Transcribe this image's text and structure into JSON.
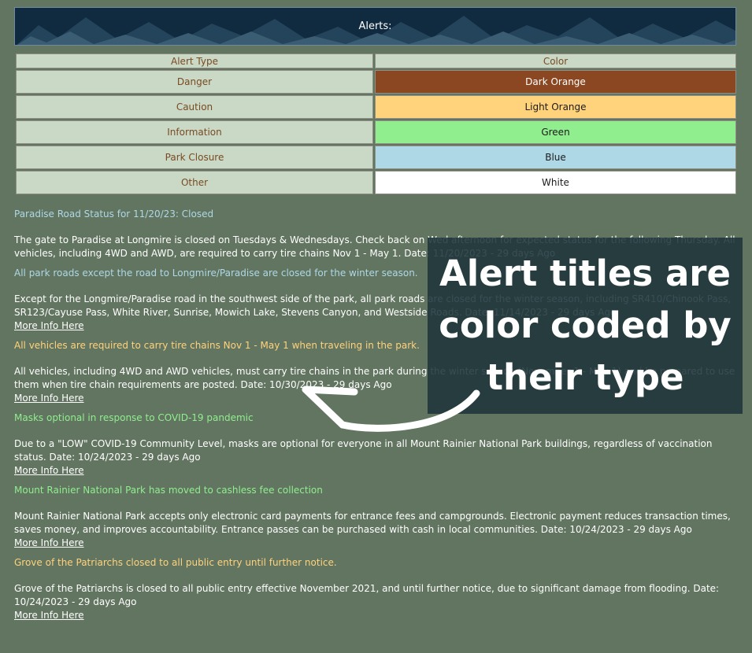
{
  "banner": {
    "title": "Alerts:"
  },
  "legend": {
    "headers": [
      "Alert Type",
      "Color"
    ],
    "rows": [
      {
        "type": "Danger",
        "color": "Dark Orange",
        "swatch": "#8b4722",
        "text_color": "#ffffff"
      },
      {
        "type": "Caution",
        "color": "Light Orange",
        "swatch": "#ffd27c",
        "text_color": "#1b1b1b"
      },
      {
        "type": "Information",
        "color": "Green",
        "swatch": "#90ee8f",
        "text_color": "#1b1b1b"
      },
      {
        "type": "Park Closure",
        "color": "Blue",
        "swatch": "#aed8e6",
        "text_color": "#1b1b1b"
      },
      {
        "type": "Other",
        "color": "White",
        "swatch": "#ffffff",
        "text_color": "#1b1b1b"
      }
    ]
  },
  "alerts": [
    {
      "title": "Paradise Road Status for 11/20/23: Closed",
      "title_color": "#aed8e6",
      "body": "The gate to Paradise at Longmire is closed on Tuesdays & Wednesdays. Check back on Wed afternoon for expected status for the following Thursday. All vehicles, including 4WD and AWD, are required to carry tire chains Nov 1 - May 1. Date: 11/20/2023 - 29 days Ago",
      "link": ""
    },
    {
      "title": "All park roads except the road to Longmire/Paradise are closed for the winter season.",
      "title_color": "#aed8e6",
      "body": "Except for the Longmire/Paradise road in the southwest side of the park, all park roads are closed for the winter season, including SR410/Chinook Pass, SR123/Cayuse Pass, White River, Sunrise, Mowich Lake, Stevens Canyon, and Westside Roads. Date: 11/14/2023 - 29 days Ago",
      "link": "More Info Here"
    },
    {
      "title": "All vehicles are required to carry tire chains Nov 1 - May 1 when traveling in the park.",
      "title_color": "#ffd27c",
      "body": "All vehicles, including 4WD and AWD vehicles, must carry tire chains in the park during the winter season (November 1 - May 1) and be prepared to use them when tire chain requirements are posted. Date: 10/30/2023 - 29 days Ago",
      "link": "More Info Here"
    },
    {
      "title": "Masks optional in response to COVID-19 pandemic",
      "title_color": "#90ee8f",
      "body": "Due to a \"LOW\" COVID-19 Community Level, masks are optional for everyone in all Mount Rainier National Park buildings, regardless of vaccination status. Date: 10/24/2023 - 29 days Ago",
      "link": "More Info Here"
    },
    {
      "title": "Mount Rainier National Park has moved to cashless fee collection",
      "title_color": "#90ee8f",
      "body": "Mount Rainier National Park accepts only electronic card payments for entrance fees and campgrounds. Electronic payment reduces transaction times, saves money, and improves accountability. Entrance passes can be purchased with cash in local communities. Date: 10/24/2023 - 29 days Ago",
      "link": "More Info Here"
    },
    {
      "title": "Grove of the Patriarchs closed to all public entry until further notice.",
      "title_color": "#ffd27c",
      "body": "Grove of the Patriarchs is closed to all public entry effective November 2021, and until further notice, due to significant damage from flooding. Date: 10/24/2023 - 29 days Ago",
      "link": "More Info Here"
    }
  ],
  "overlay": {
    "text": "Alert titles are color coded by their type"
  }
}
